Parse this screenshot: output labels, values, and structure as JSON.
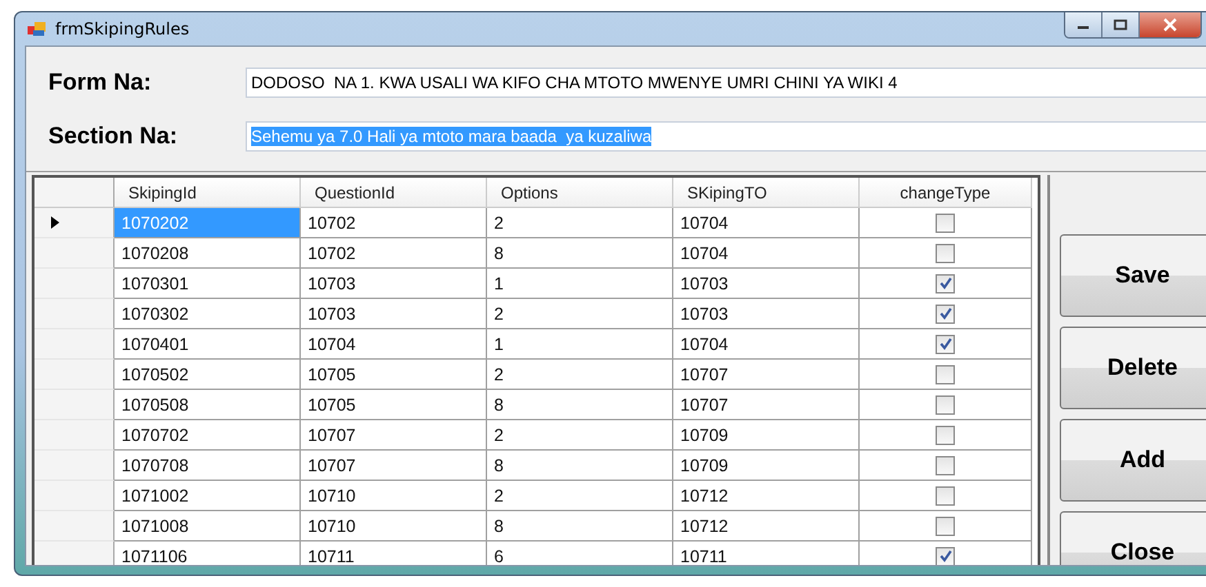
{
  "window": {
    "title": "frmSkipingRules"
  },
  "form_name": {
    "label": "Form Na:",
    "value": "DODOSO  NA 1. KWA USALI WA KIFO CHA MTOTO MWENYE UMRI CHINI YA WIKI 4"
  },
  "section_name": {
    "label": "Section Na:",
    "value": "Sehemu ya 7.0 Hali ya mtoto mara baada  ya kuzaliwa",
    "text_selected": true
  },
  "table": {
    "columns": [
      "SkipingId",
      "QuestionId",
      "Options",
      "SKipingTO",
      "changeType"
    ],
    "rows": [
      {
        "cells": [
          "1070202",
          "10702",
          "2",
          "10704"
        ],
        "checked": false,
        "selected": true
      },
      {
        "cells": [
          "1070208",
          "10702",
          "8",
          "10704"
        ],
        "checked": false,
        "selected": false
      },
      {
        "cells": [
          "1070301",
          "10703",
          "1",
          "10703"
        ],
        "checked": true,
        "selected": false
      },
      {
        "cells": [
          "1070302",
          "10703",
          "2",
          "10703"
        ],
        "checked": true,
        "selected": false
      },
      {
        "cells": [
          "1070401",
          "10704",
          "1",
          "10704"
        ],
        "checked": true,
        "selected": false
      },
      {
        "cells": [
          "1070502",
          "10705",
          "2",
          "10707"
        ],
        "checked": false,
        "selected": false
      },
      {
        "cells": [
          "1070508",
          "10705",
          "8",
          "10707"
        ],
        "checked": false,
        "selected": false
      },
      {
        "cells": [
          "1070702",
          "10707",
          "2",
          "10709"
        ],
        "checked": false,
        "selected": false
      },
      {
        "cells": [
          "1070708",
          "10707",
          "8",
          "10709"
        ],
        "checked": false,
        "selected": false
      },
      {
        "cells": [
          "1071002",
          "10710",
          "2",
          "10712"
        ],
        "checked": false,
        "selected": false
      },
      {
        "cells": [
          "1071008",
          "10710",
          "8",
          "10712"
        ],
        "checked": false,
        "selected": false
      },
      {
        "cells": [
          "1071106",
          "10711",
          "6",
          "10711"
        ],
        "checked": true,
        "selected": false
      }
    ]
  },
  "buttons": [
    "Save",
    "Delete",
    "Add",
    "Close"
  ]
}
